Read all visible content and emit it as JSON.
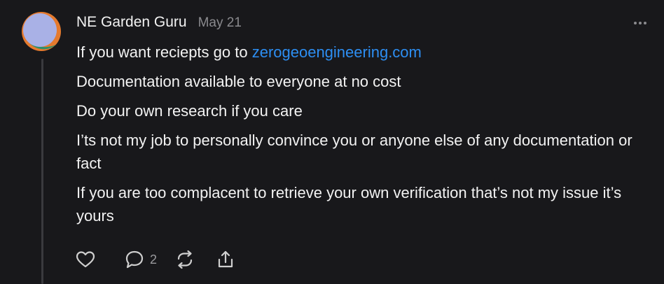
{
  "post": {
    "author": "NE Garden Guru",
    "date": "May 21",
    "line1_prefix": "If you want reciepts go to ",
    "line1_link": "zerogeoengineering.com",
    "paragraphs": [
      "Documentation available to everyone at no cost",
      "Do your own research if you care",
      "I’ts not my job to personally convince you or anyone else of any documentation or fact",
      "If you are too complacent to retrieve your own verification that’s not my issue it’s yours"
    ],
    "reply_count": "2"
  },
  "icons": {
    "more": "more-horizontal-icon",
    "like": "heart-icon",
    "reply": "comment-bubble-icon",
    "repost": "repost-icon",
    "share": "share-icon"
  },
  "colors": {
    "background": "#18181b",
    "link": "#2d8ef2",
    "muted": "#8a8a8e"
  }
}
